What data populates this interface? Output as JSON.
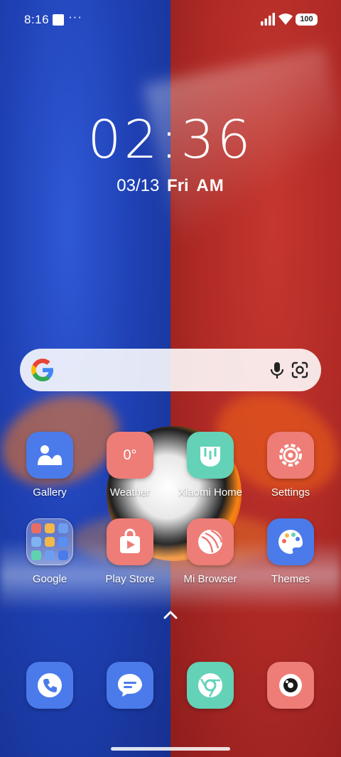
{
  "status_bar": {
    "time": "8:16",
    "overflow": "···",
    "battery": "100"
  },
  "clock": {
    "time": "02:36",
    "date": "03/13",
    "day": "Fri",
    "ampm": "AM"
  },
  "search": {
    "icons": [
      "google-g-icon",
      "mic-icon",
      "google-lens-icon"
    ]
  },
  "apps_row1": [
    {
      "label": "Gallery",
      "icon": "gallery-icon"
    },
    {
      "label": "Weather",
      "icon": "weather-icon",
      "value": "0°"
    },
    {
      "label": "Xiaomi Home",
      "icon": "xiaomi-home-icon"
    },
    {
      "label": "Settings",
      "icon": "gear-icon"
    }
  ],
  "apps_row2": [
    {
      "label": "Google",
      "icon": "google-folder-icon"
    },
    {
      "label": "Play Store",
      "icon": "play-store-icon"
    },
    {
      "label": "Mi Browser",
      "icon": "mi-browser-icon"
    },
    {
      "label": "Themes",
      "icon": "themes-palette-icon"
    }
  ],
  "dock": [
    {
      "icon": "phone-icon"
    },
    {
      "icon": "messages-icon"
    },
    {
      "icon": "chrome-icon"
    },
    {
      "icon": "camera-icon"
    }
  ],
  "colors": {
    "wallpaper_left": "#1f41b5",
    "wallpaper_right": "#b02a26",
    "tile_blue": "#4b7bea",
    "tile_salmon": "#ee7d77",
    "tile_teal": "#63d2b7"
  }
}
